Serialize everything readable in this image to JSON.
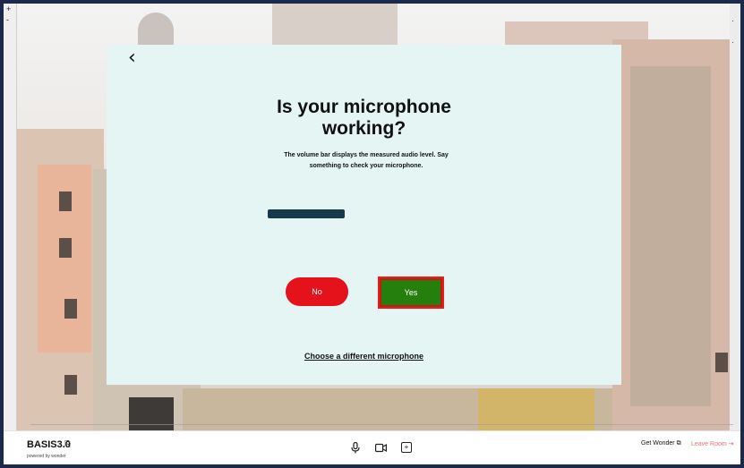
{
  "left_controls": {
    "zoom_in": "+",
    "zoom_out": "-"
  },
  "modal": {
    "back_symbol": "‹",
    "title_line1": "Is your microphone",
    "title_line2": "working?",
    "description": "The volume bar displays the measured audio level. Say something to check your microphone.",
    "audio_level_percent": 43,
    "no_button": "No",
    "yes_button": "Yes",
    "choose_link": "Choose a different microphone"
  },
  "bottom_bar": {
    "room_name": "BASIS3.0",
    "powered_by": "powered by wonder",
    "get_wonder": "Get Wonder",
    "leave_room": "Leave Room"
  },
  "icons": [
    "chevron-left-icon",
    "copy-icon",
    "microphone-icon",
    "camera-icon",
    "screen-share-icon",
    "external-link-icon",
    "exit-icon"
  ],
  "colors": {
    "modal_bg": "#e5f5f3",
    "no": "#e5121b",
    "yes": "#247f0c",
    "highlight": "#e3201b",
    "meter": "#163a4a"
  }
}
